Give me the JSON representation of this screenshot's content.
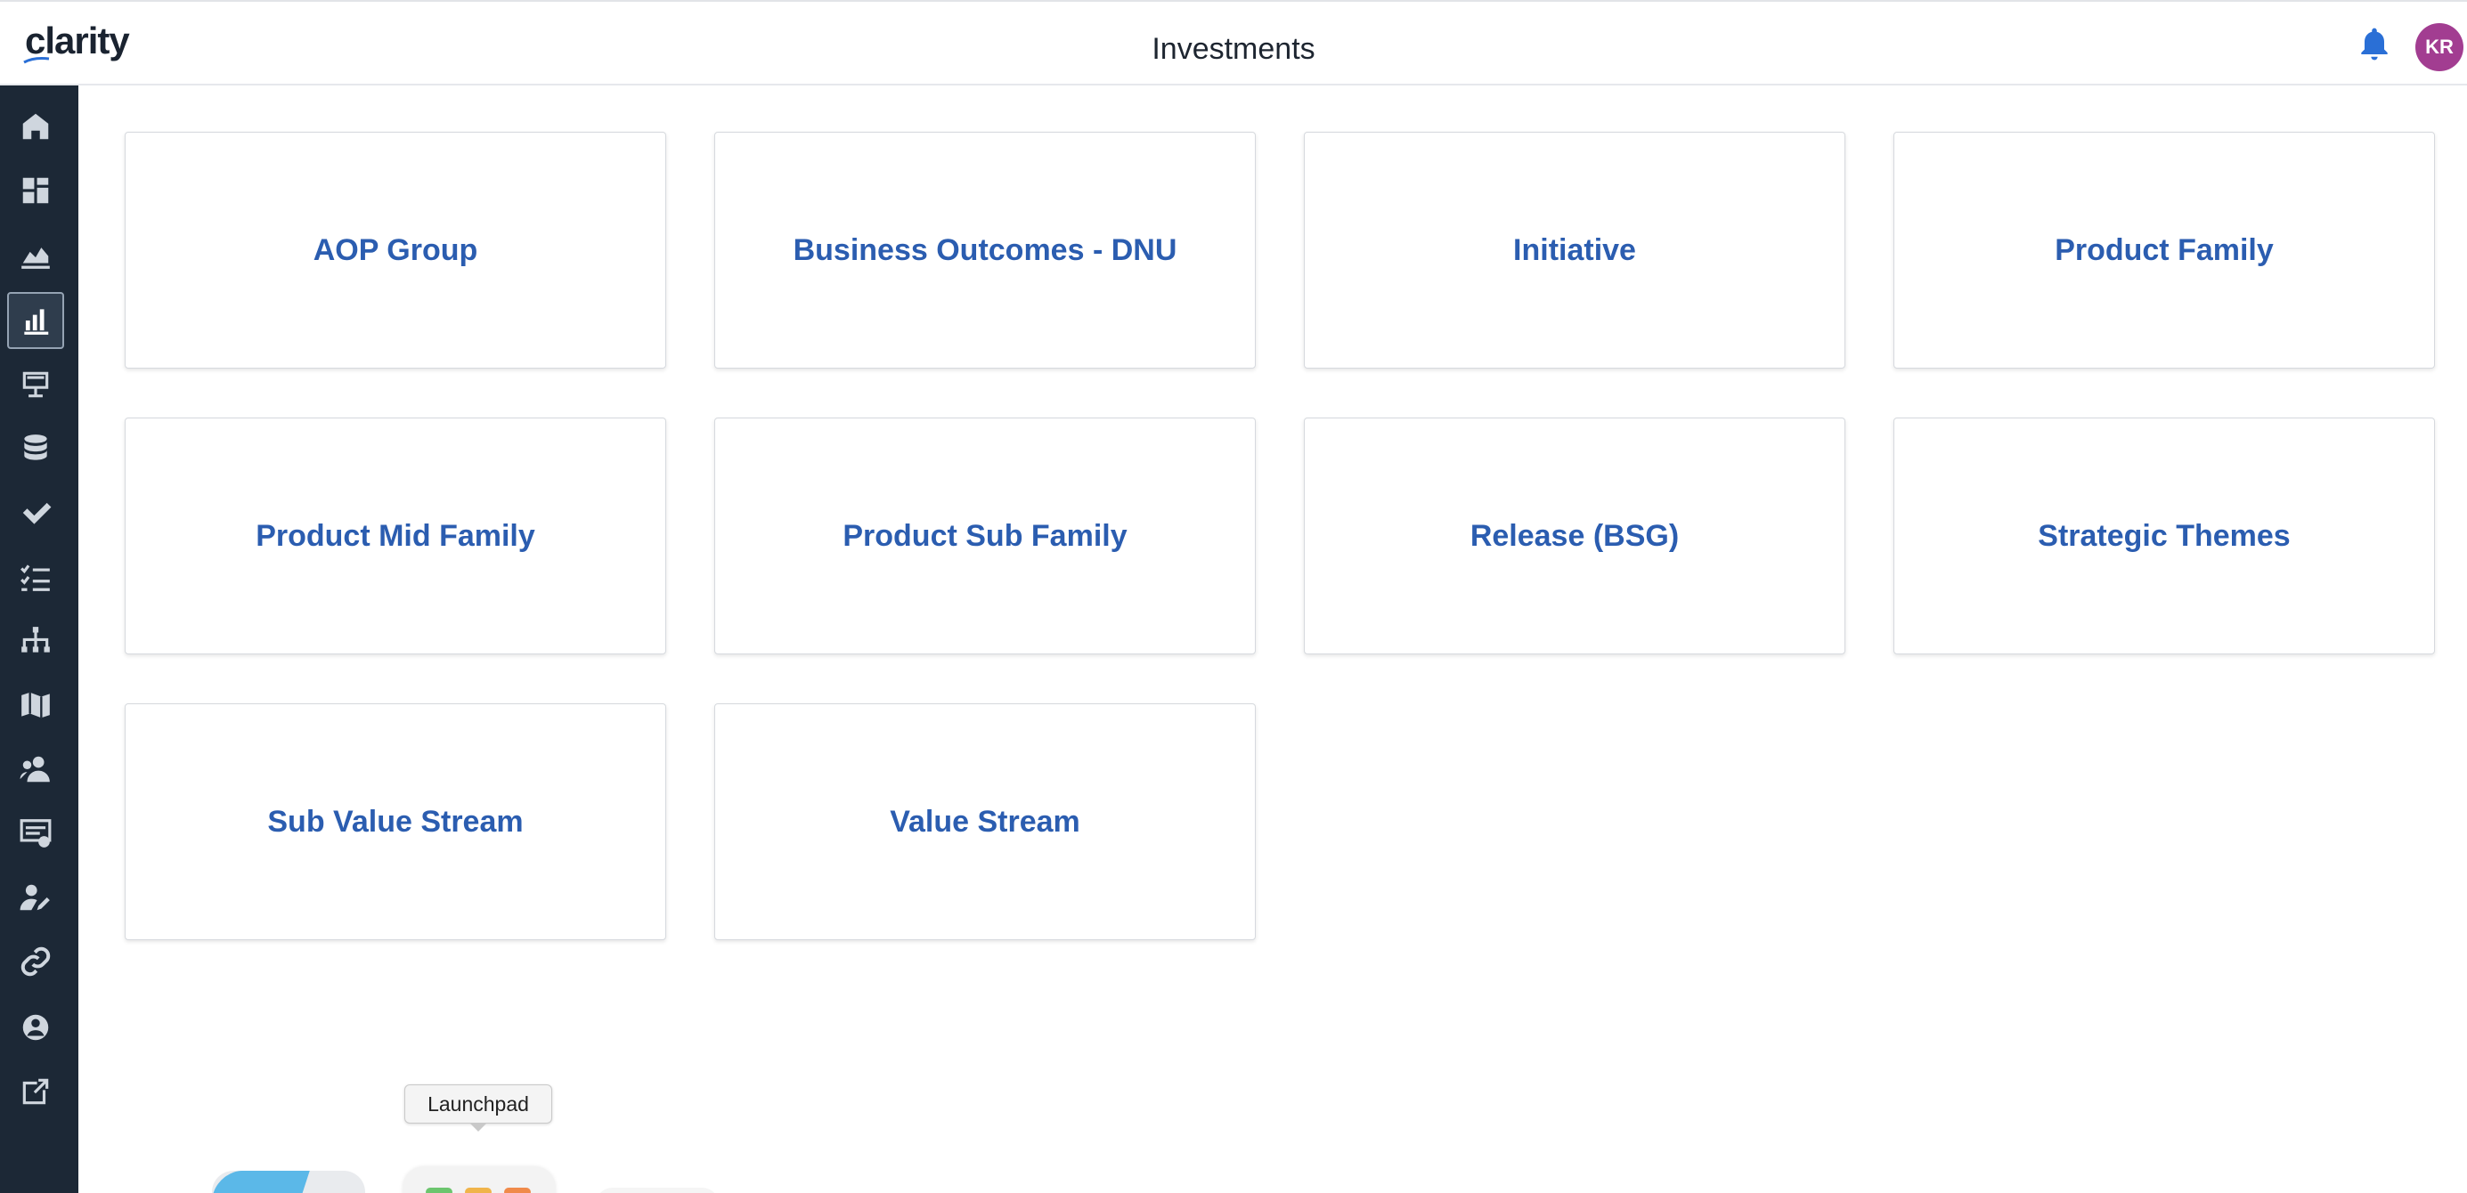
{
  "header": {
    "logo_text": "clarity",
    "page_title": "Investments",
    "notification_icon": "bell-icon",
    "avatar_initials": "KR",
    "avatar_color": "#a23d91"
  },
  "sidebar": {
    "background": "#1c2836",
    "items": [
      {
        "icon": "home-icon"
      },
      {
        "icon": "dashboard-grid-icon"
      },
      {
        "icon": "area-chart-icon"
      },
      {
        "icon": "bar-chart-icon",
        "active": true
      },
      {
        "icon": "presentation-icon"
      },
      {
        "icon": "database-icon"
      },
      {
        "icon": "checkmark-icon"
      },
      {
        "icon": "checklist-icon"
      },
      {
        "icon": "hierarchy-icon"
      },
      {
        "icon": "map-icon"
      },
      {
        "icon": "team-icon"
      },
      {
        "icon": "timesheet-icon"
      },
      {
        "icon": "user-edit-icon"
      },
      {
        "icon": "link-icon"
      },
      {
        "icon": "admin-settings-icon"
      },
      {
        "icon": "external-link-icon"
      }
    ]
  },
  "cards": [
    {
      "label": "AOP Group"
    },
    {
      "label": "Business Outcomes - DNU"
    },
    {
      "label": "Initiative"
    },
    {
      "label": "Product Family"
    },
    {
      "label": "Product Mid Family"
    },
    {
      "label": "Product Sub Family"
    },
    {
      "label": "Release (BSG)"
    },
    {
      "label": "Strategic Themes"
    },
    {
      "label": "Sub Value Stream"
    },
    {
      "label": "Value Stream"
    }
  ],
  "launchpad_tooltip": "Launchpad",
  "colors": {
    "card_label": "#2b5db0",
    "accent": "#2b5db0"
  }
}
